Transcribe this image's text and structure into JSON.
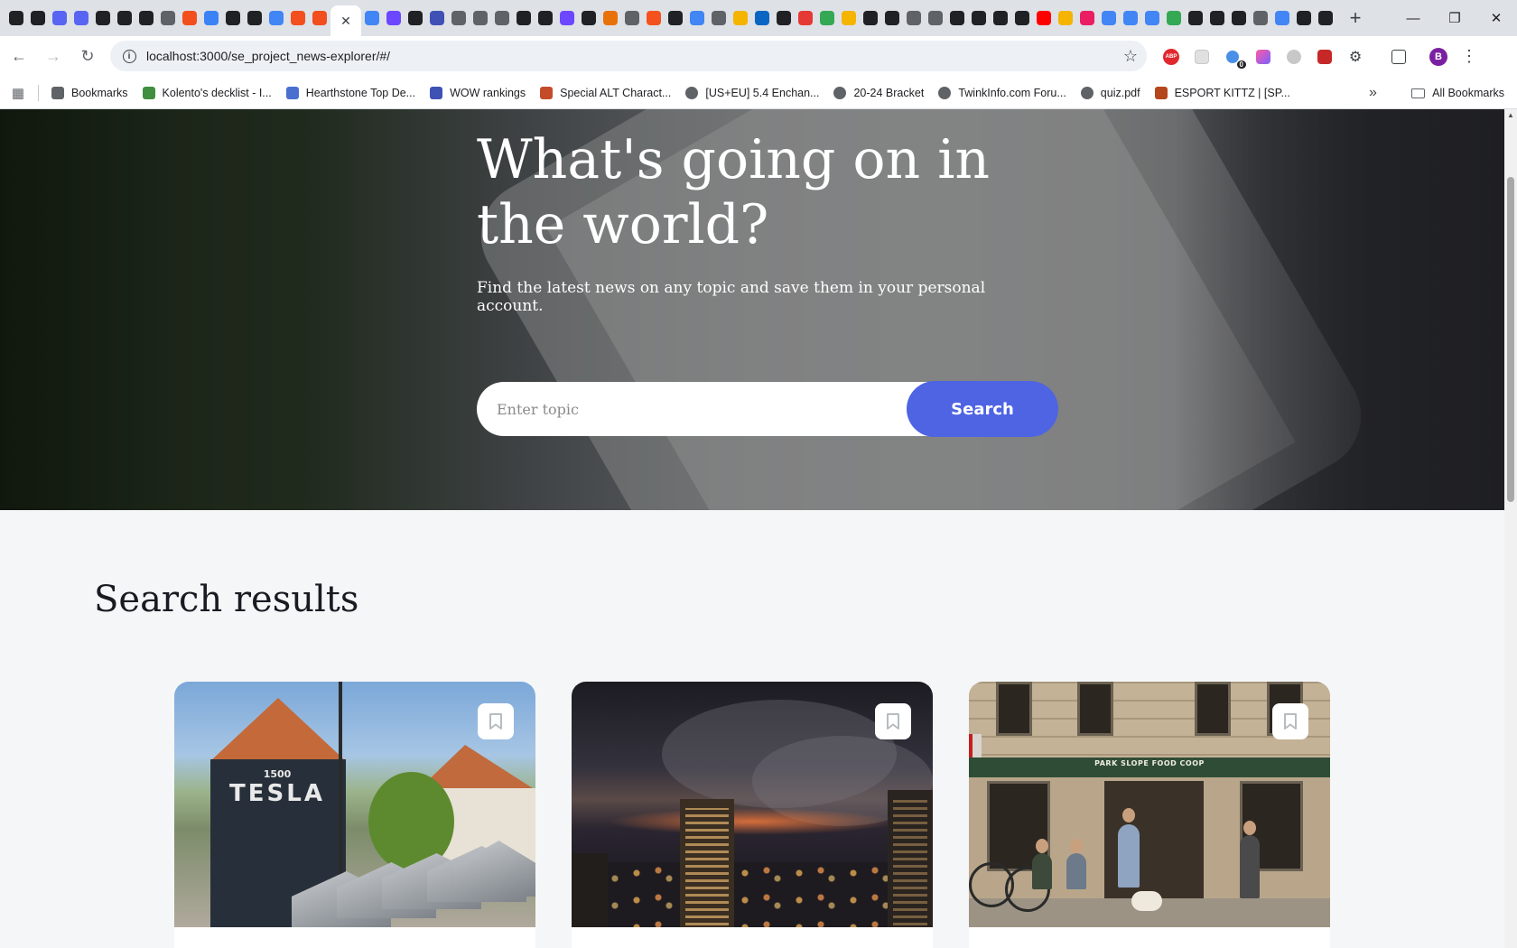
{
  "browser": {
    "tab_favicon_colors": [
      "#202124",
      "#202124",
      "#5865f2",
      "#5865f2",
      "#202124",
      "#202124",
      "#202124",
      "#5f6368",
      "#f24e1e",
      "#3b82f6",
      "#202124",
      "#202124",
      "#4285f4",
      "#f24e1e",
      "#f24e1e",
      "#4285f4",
      "#6c47ff",
      "#202124",
      "#3f51b5",
      "#5f6368",
      "#5f6368",
      "#5f6368",
      "#202124",
      "#202124",
      "#6c47ff",
      "#202124",
      "#e8710a",
      "#5f6368",
      "#f4511e",
      "#202124",
      "#4285f4",
      "#5f6368",
      "#f4b400",
      "#0a66c2",
      "#202124",
      "#e53935",
      "#34a853",
      "#f4b400",
      "#202124",
      "#202124",
      "#5f6368",
      "#5f6368",
      "#202124",
      "#202124",
      "#202124",
      "#202124",
      "#ff0000",
      "#f4b400",
      "#e91e63",
      "#4285f4",
      "#4285f4",
      "#4285f4",
      "#34a853",
      "#202124",
      "#202124",
      "#202124",
      "#5f6368",
      "#4285f4",
      "#202124",
      "#202124"
    ],
    "active_tab_close": "✕",
    "new_tab": "+",
    "url": "localhost:3000/se_project_news-explorer/#/",
    "profile_initial": "B",
    "extension_badge": "0",
    "abp_label": "ABP"
  },
  "bookmarks_bar": {
    "items": [
      {
        "label": "Bookmarks",
        "icon": "star-icon",
        "color": "#5f6368"
      },
      {
        "label": "Kolento's decklist - I...",
        "icon": "game-icon",
        "color": "#3f8f3f"
      },
      {
        "label": "Hearthstone Top De...",
        "icon": "gem-icon",
        "color": "#4a6fd1"
      },
      {
        "label": "WOW rankings",
        "icon": "wow-icon",
        "color": "#3f51b5"
      },
      {
        "label": "Special ALT Charact...",
        "icon": "arch-icon",
        "color": "#c44b2a"
      },
      {
        "label": "[US+EU] 5.4 Enchan...",
        "icon": "globe-icon",
        "color": "#5f6368"
      },
      {
        "label": "20-24 Bracket",
        "icon": "globe-icon",
        "color": "#5f6368"
      },
      {
        "label": "TwinkInfo.com Foru...",
        "icon": "globe-icon",
        "color": "#5f6368"
      },
      {
        "label": "quiz.pdf",
        "icon": "globe-icon",
        "color": "#5f6368"
      },
      {
        "label": "ESPORT KITTZ | [SP...",
        "icon": "esport-icon",
        "color": "#b5451b"
      }
    ],
    "all_bookmarks": "All Bookmarks"
  },
  "hero": {
    "title": "What's going on in the world?",
    "subtitle": "Find the latest news on any topic and save them in your personal account.",
    "search": {
      "placeholder": "Enter topic",
      "value": "",
      "button_label": "Search",
      "button_color": "#4e64e3"
    }
  },
  "results": {
    "title": "Search results",
    "cards": [
      {
        "image": "tesla-dealership",
        "saved": false
      },
      {
        "image": "night-city-smoke",
        "saved": false
      },
      {
        "image": "park-slope-food-coop",
        "saved": false
      }
    ],
    "card3_sign": "PARK SLOPE FOOD COOP",
    "card1_sign_number": "1500",
    "card1_sign_brand": "TESLA"
  }
}
